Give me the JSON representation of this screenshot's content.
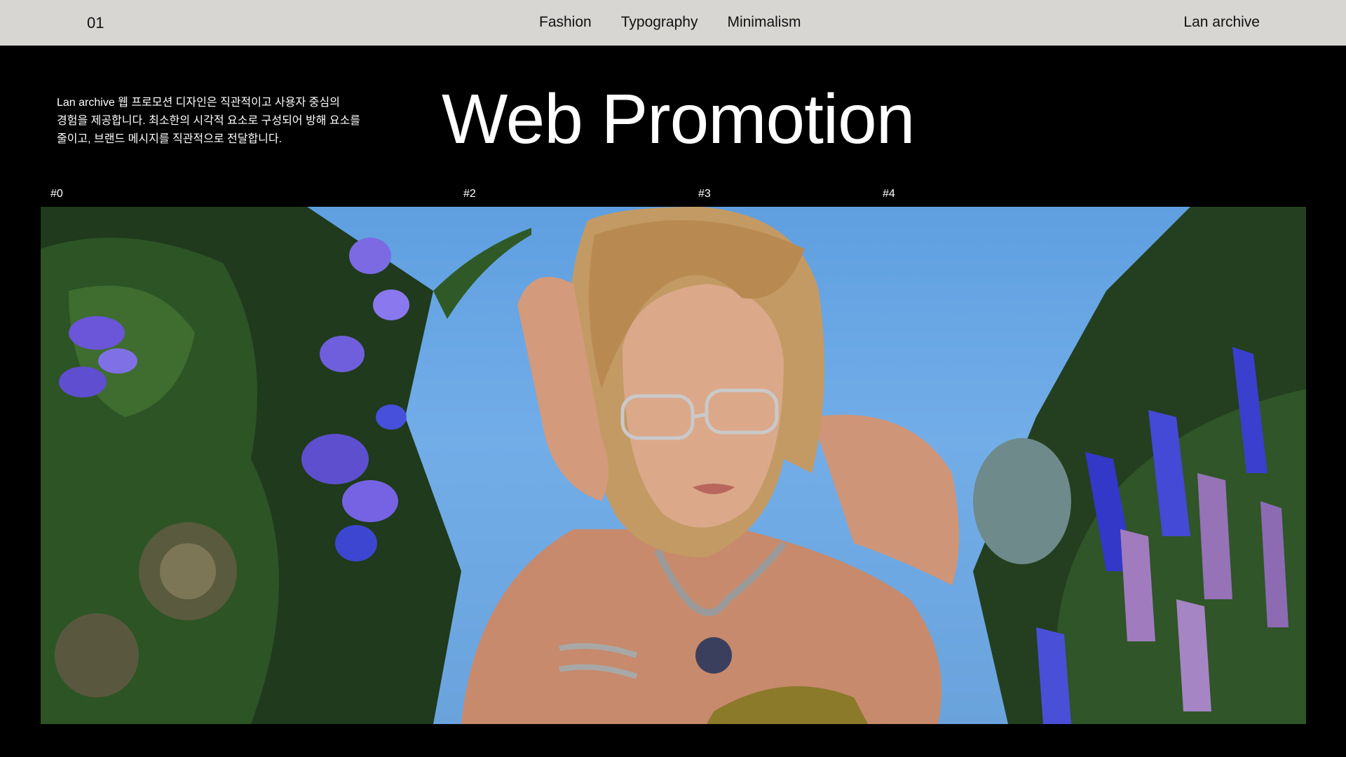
{
  "header": {
    "page_number": "01",
    "nav": [
      "Fashion",
      "Typography",
      "Minimalism"
    ],
    "brand": "Lan archive"
  },
  "intro": {
    "lines": [
      "Lan archive 웹 프로모션 디자인은 직관적이고 사용자 중심의",
      "경험을 제공합니다. 최소한의 시각적 요소로 구성되어 방해 요소를",
      "줄이고, 브랜드 메시지를 직관적으로 전달합니다."
    ]
  },
  "hero": {
    "title": "Web Promotion"
  },
  "markers": [
    "#0",
    "#2",
    "#3",
    "#4"
  ],
  "photo": {
    "icon": "fashion-portrait-image"
  },
  "colors": {
    "topbar": "#d7d6d3",
    "background": "#000000",
    "sky": "#6aa7e4"
  }
}
